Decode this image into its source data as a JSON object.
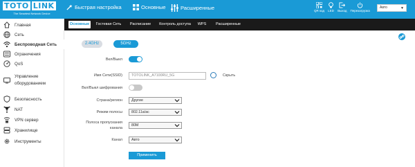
{
  "brand": {
    "logo_left": "TOTO",
    "logo_right": "LINK",
    "tagline": "The Smartest Network Device"
  },
  "header": {
    "modes": [
      {
        "label": "Быстрая настройка",
        "icon": "wand-icon"
      },
      {
        "label": "Основные",
        "icon": "grid-icon"
      },
      {
        "label": "Расширенные",
        "icon": "sliders-icon"
      }
    ],
    "tools": [
      {
        "label": "QR код",
        "icon": "qr-code-icon"
      },
      {
        "label": "LED",
        "icon": "lightbulb-icon"
      },
      {
        "label": "Выход",
        "icon": "logout-icon"
      },
      {
        "label": "Перезагрузка",
        "icon": "power-icon"
      }
    ],
    "language": "Авто"
  },
  "sidebar": {
    "items": [
      {
        "label": "Главная",
        "icon": "home-icon"
      },
      {
        "label": "Сеть",
        "icon": "globe-icon"
      },
      {
        "label": "Беспроводная Сеть",
        "icon": "wifi-icon",
        "active": true
      },
      {
        "label": "Ограничения",
        "icon": "filter-icon"
      },
      {
        "label": "QoS",
        "icon": "qos-icon"
      },
      {
        "label_line1": "Управление",
        "label_line2": "оборудованием",
        "icon": "device-icon"
      },
      {
        "label": "Безопасность",
        "icon": "shield-icon"
      },
      {
        "label": "NAT",
        "icon": "nat-icon"
      },
      {
        "label": "VPN сервер",
        "icon": "vpn-icon"
      },
      {
        "label": "Хранилище",
        "icon": "storage-icon"
      },
      {
        "label": "Инструменты",
        "icon": "gear-icon"
      }
    ]
  },
  "tabs": [
    {
      "label": "Основные",
      "active": true
    },
    {
      "label": "Гостевая Сеть"
    },
    {
      "label": "Расписание"
    },
    {
      "label": "Контроль доступа"
    },
    {
      "label": "WPS"
    },
    {
      "label": "Расширенные"
    }
  ],
  "bands": {
    "band_24": "2.4GHz",
    "band_5": "5GHz",
    "selected": "5GHz"
  },
  "form": {
    "wifi_label": "Вкл/Выкл",
    "wifi_on": true,
    "ssid_label": "Имя Сети(SSID)",
    "ssid_value": "TOTOLINK_A7100RU_5G",
    "hide_label": "Скрыть",
    "encrypt_label": "Вкл/Выкл шифрования",
    "encrypt_on": false,
    "region_label": "Страна/регион",
    "region_value": "Другие",
    "mode_label": "Режим полосы",
    "mode_value": "802.11a/ac",
    "bandwidth_label_line1": "Полоса пропускания",
    "bandwidth_label_line2": "канала",
    "bandwidth_value": "80M",
    "channel_label": "Канал",
    "channel_value": "Авто",
    "apply_label": "Применить"
  },
  "colors": {
    "accent": "#1a9ad6",
    "tabbar": "#1a1a1a",
    "toggle_off": "#c8c8c8"
  }
}
